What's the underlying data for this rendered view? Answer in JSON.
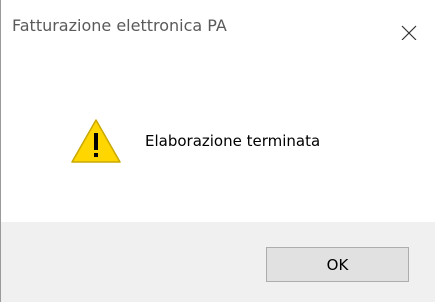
{
  "window": {
    "title": "Fatturazione elettronica PA",
    "close_icon": "close-icon"
  },
  "content": {
    "icon": "warning-icon",
    "message": "Elaborazione terminata"
  },
  "buttons": {
    "ok_label": "OK"
  },
  "colors": {
    "warning_fill": "#ffd600",
    "footer_bg": "#f0f0f0",
    "button_bg": "#e1e1e1",
    "button_border": "#adadad"
  }
}
